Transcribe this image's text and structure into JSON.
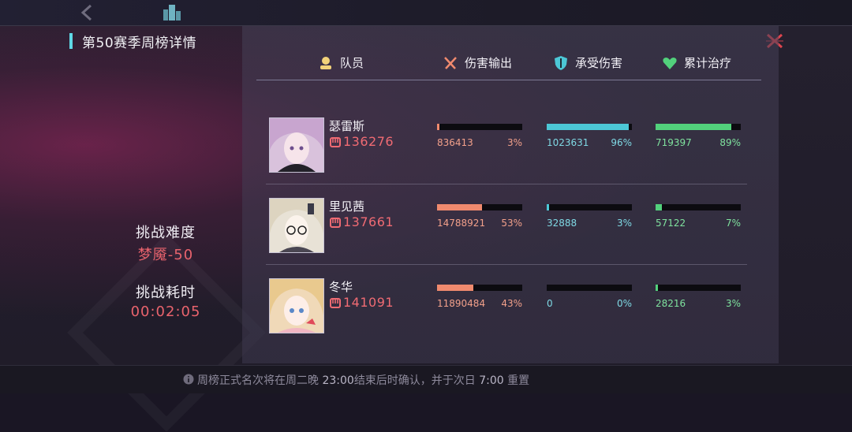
{
  "panel": {
    "title": "第50赛季周榜详情"
  },
  "header": {
    "member": "队员",
    "damage": "伤害输出",
    "tank": "承受伤害",
    "heal": "累计治疗"
  },
  "challenge": {
    "difficulty_label": "挑战难度",
    "difficulty_value": "梦魇-50",
    "time_label": "挑战耗时",
    "time_value": "00:02:05"
  },
  "members": [
    {
      "name": "瑟雷斯",
      "power": "136276",
      "damage": {
        "value": "836413",
        "percent": "3%",
        "ratio": 0.03
      },
      "tank": {
        "value": "1023631",
        "percent": "96%",
        "ratio": 0.96
      },
      "heal": {
        "value": "719397",
        "percent": "89%",
        "ratio": 0.89
      }
    },
    {
      "name": "里见茜",
      "power": "137661",
      "damage": {
        "value": "14788921",
        "percent": "53%",
        "ratio": 0.53
      },
      "tank": {
        "value": "32888",
        "percent": "3%",
        "ratio": 0.03
      },
      "heal": {
        "value": "57122",
        "percent": "7%",
        "ratio": 0.07
      }
    },
    {
      "name": "冬华",
      "power": "141091",
      "damage": {
        "value": "11890484",
        "percent": "43%",
        "ratio": 0.43
      },
      "tank": {
        "value": "0",
        "percent": "0%",
        "ratio": 0.0
      },
      "heal": {
        "value": "28216",
        "percent": "3%",
        "ratio": 0.03
      }
    }
  ],
  "footer": {
    "text_a": "周榜正式名次将在周二晚 ",
    "time_a": "23:00",
    "text_b": "结束后时确认，并于次日 ",
    "time_b": "7:00",
    "text_c": " 重置"
  },
  "colors": {
    "accent": "#5fd8e6",
    "power": "#f06b73",
    "damage": "#f08a6e",
    "tank": "#4cc7d6",
    "heal": "#52d17c",
    "close": "#e0454e"
  },
  "icons": [
    "back-arrow-icon",
    "building-icon",
    "close-icon",
    "member-icon",
    "swords-icon",
    "shield-icon",
    "heart-icon",
    "power-fist-icon",
    "info-icon"
  ]
}
